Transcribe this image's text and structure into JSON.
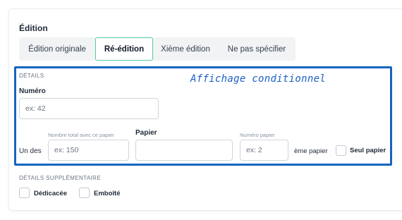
{
  "edition": {
    "title": "Édition",
    "tabs": [
      {
        "label": "Édition originale",
        "active": false
      },
      {
        "label": "Ré-édition",
        "active": true
      },
      {
        "label": "Xième édition",
        "active": false
      },
      {
        "label": "Ne pas spécifier",
        "active": false
      }
    ]
  },
  "details": {
    "section_label": "DÉTAILS",
    "annotation": "Affichage conditionnel",
    "numero_label": "Numéro",
    "numero_placeholder": "ex: 42",
    "total_hint": "Nombre total avec ce papier",
    "papier_label": "Papier",
    "numero_papier_hint": "Numéro papier",
    "un_des": "Un des",
    "total_placeholder": "ex: 150",
    "papier_value": "",
    "numero_papier_placeholder": "ex: 2",
    "eme_papier": "ème papier",
    "seul_papier_label": "Seul papier",
    "seul_papier_checked": false
  },
  "extra": {
    "section_label": "DÉTAILS SUPPLÉMENTAIRE",
    "dedicacee_label": "Dédicacée",
    "dedicacee_checked": false,
    "emboite_label": "Emboîté",
    "emboite_checked": false
  },
  "colors": {
    "accent_tab_border": "#56c8a4",
    "annotation_blue": "#1565c0"
  }
}
